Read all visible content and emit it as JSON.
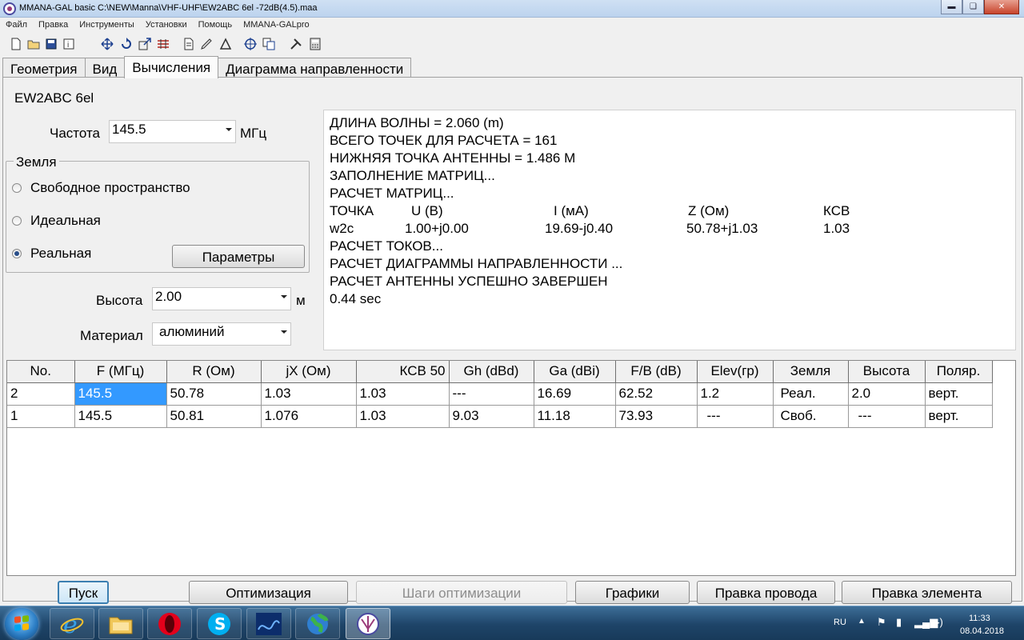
{
  "window": {
    "title": "MMANA-GAL basic C:\\NEW\\Manna\\VHF-UHF\\EW2ABC 6el -72dB(4.5).maa",
    "app_icon": "mmana-icon",
    "minimize_icon": "minimize-icon",
    "maximize_icon": "restore-icon",
    "close_icon": "close-icon"
  },
  "menu": [
    "Файл",
    "Правка",
    "Инструменты",
    "Установки",
    "Помощь",
    "MMANA-GALpro"
  ],
  "toolbar": {
    "icons": [
      "new-file-icon",
      "open-folder-icon",
      "save-icon",
      "info-icon",
      "move-icon",
      "rotate-icon",
      "stretch-icon",
      "wires-icon",
      "document-icon",
      "edit-icon",
      "triangle-icon",
      "target-icon",
      "copy-icon",
      "tools-icon",
      "calculator-icon"
    ]
  },
  "tabs": [
    {
      "label": "Геометрия",
      "active": false
    },
    {
      "label": "Вид",
      "active": false
    },
    {
      "label": "Вычисления",
      "active": true
    },
    {
      "label": "Диаграмма направленности",
      "active": false
    }
  ],
  "calc": {
    "antenna_name": "EW2ABC 6el",
    "freq_label": "Частота",
    "freq_value": "145.5",
    "freq_unit": "МГц",
    "ground_title": "Земля",
    "ground_options": [
      {
        "label": "Свободное пространство",
        "checked": false
      },
      {
        "label": "Идеальная",
        "checked": false
      },
      {
        "label": "Реальная",
        "checked": true
      }
    ],
    "params_button": "Параметры",
    "height_label": "Высота",
    "height_value": "2.00",
    "height_unit": "м",
    "material_label": "Материал",
    "material_value": "алюминий"
  },
  "log": {
    "lines_before": [
      "ДЛИНА ВОЛНЫ = 2.060 (m)",
      "ВСЕГО ТОЧЕК ДЛЯ РАСЧЕТА = 161",
      "НИЖНЯЯ ТОЧКА АНТЕННЫ = 1.486 М",
      "ЗАПОЛНЕНИЕ МАТРИЦ...",
      "РАСЧЕТ МАТРИЦ..."
    ],
    "header": [
      "ТОЧКА",
      "U (В)",
      "I (мА)",
      "Z (Ом)",
      "КСВ"
    ],
    "row": [
      "w2c",
      "1.00+j0.00",
      "19.69-j0.40",
      "50.78+j1.03",
      "1.03"
    ],
    "lines_after": [
      "РАСЧЕТ ТОКОВ...",
      "РАСЧЕТ ДИАГРАММЫ НАПРАВЛЕННОСТИ ...",
      "РАСЧЕТ АНТЕННЫ УСПЕШНО ЗАВЕРШЕН",
      "0.44 sec"
    ]
  },
  "results": {
    "columns": [
      "No.",
      "F (МГц)",
      "R (Ом)",
      "jX (Ом)",
      "КСВ 50",
      "Gh (dBd)",
      "Ga (dBi)",
      "F/B (dB)",
      "Elev(гр)",
      "Земля",
      "Высота",
      "Поляр."
    ],
    "rows": [
      [
        "2",
        "145.5",
        "50.78",
        "1.03",
        "1.03",
        "---",
        "16.69",
        "62.52",
        "1.2",
        "Реал.",
        "2.0",
        "верт."
      ],
      [
        "1",
        "145.5",
        "50.81",
        "1.076",
        "1.03",
        "9.03",
        "11.18",
        "73.93",
        "---",
        "Своб.",
        "---",
        "верт."
      ]
    ]
  },
  "buttons": {
    "start": "Пуск",
    "optimize": "Оптимизация",
    "optimize_steps": "Шаги оптимизации",
    "graphs": "Графики",
    "edit_wire": "Правка провода",
    "edit_element": "Правка элемента"
  },
  "taskbar": {
    "apps": [
      "internet-explorer-icon",
      "file-explorer-icon",
      "opera-icon",
      "skype-icon",
      "app-icon",
      "globe-icon",
      "mmana-icon"
    ],
    "language": "RU",
    "time": "11:33",
    "date": "08.04.2018"
  }
}
